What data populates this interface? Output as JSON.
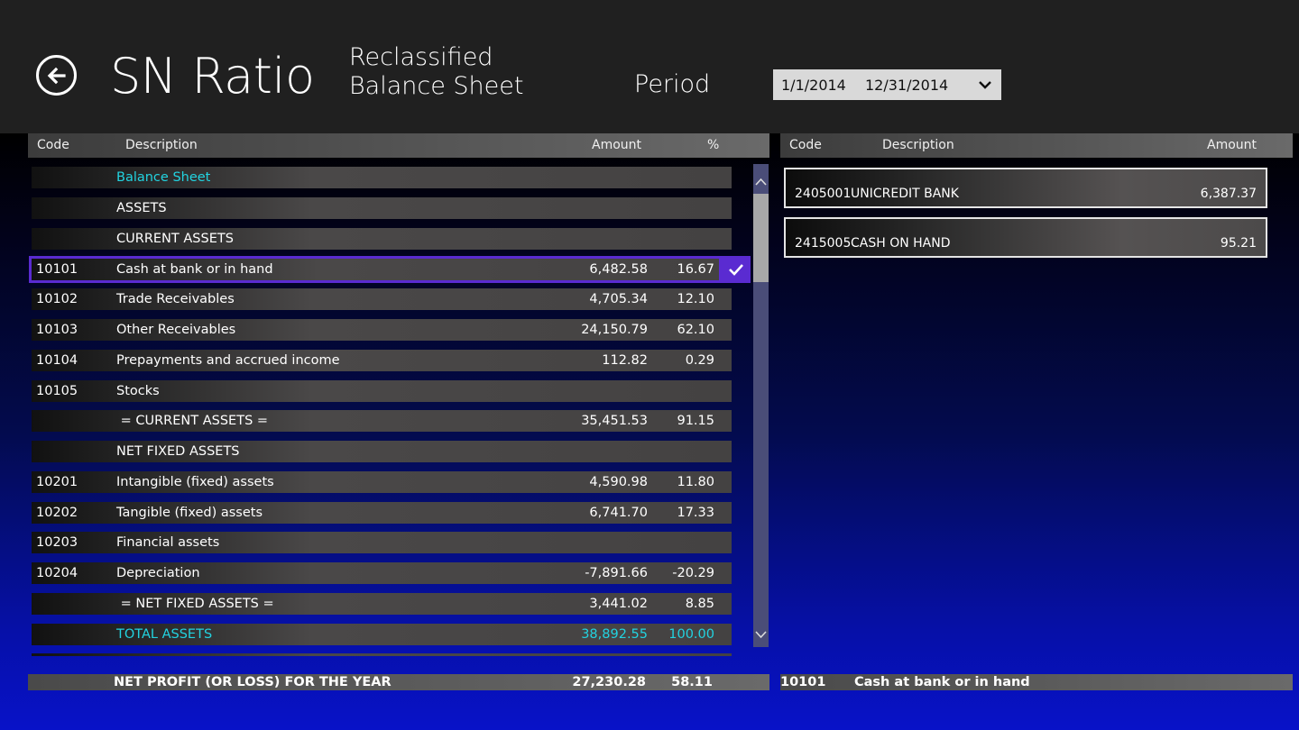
{
  "header": {
    "app_title": "SN Ratio",
    "report_title": "Reclassified Balance Sheet",
    "period_label": "Period",
    "period_from": "1/1/2014",
    "period_to": "12/31/2014"
  },
  "left_table": {
    "columns": {
      "code": "Code",
      "description": "Description",
      "amount": "Amount",
      "percent": "%"
    },
    "rows": [
      {
        "code": "",
        "description": "Balance Sheet",
        "amount": "",
        "percent": ""
      },
      {
        "code": "",
        "description": "ASSETS",
        "amount": "",
        "percent": ""
      },
      {
        "code": "",
        "description": "CURRENT ASSETS",
        "amount": "",
        "percent": ""
      },
      {
        "code": "10101",
        "description": "Cash at bank or in hand",
        "amount": "6,482.58",
        "percent": "16.67"
      },
      {
        "code": "10102",
        "description": "Trade Receivables",
        "amount": "4,705.34",
        "percent": "12.10"
      },
      {
        "code": "10103",
        "description": "Other Receivables",
        "amount": "24,150.79",
        "percent": "62.10"
      },
      {
        "code": "10104",
        "description": "Prepayments and accrued income",
        "amount": "112.82",
        "percent": "0.29"
      },
      {
        "code": "10105",
        "description": "Stocks",
        "amount": "",
        "percent": ""
      },
      {
        "code": "",
        "description": " = CURRENT ASSETS =",
        "amount": "35,451.53",
        "percent": "91.15"
      },
      {
        "code": "",
        "description": "NET FIXED ASSETS",
        "amount": "",
        "percent": ""
      },
      {
        "code": "10201",
        "description": "Intangible (fixed) assets",
        "amount": "4,590.98",
        "percent": "11.80"
      },
      {
        "code": "10202",
        "description": "Tangible (fixed) assets",
        "amount": "6,741.70",
        "percent": "17.33"
      },
      {
        "code": "10203",
        "description": "Financial assets",
        "amount": "",
        "percent": ""
      },
      {
        "code": "10204",
        "description": "Depreciation",
        "amount": "-7,891.66",
        "percent": "-20.29"
      },
      {
        "code": "",
        "description": " = NET FIXED ASSETS =",
        "amount": "3,441.02",
        "percent": "8.85"
      },
      {
        "code": "",
        "description": "TOTAL ASSETS",
        "amount": "38,892.55",
        "percent": "100.00"
      }
    ]
  },
  "right_table": {
    "columns": {
      "code": "Code",
      "description": "Description",
      "amount": "Amount"
    },
    "items": [
      {
        "code": "2405001",
        "description": "UNICREDIT BANK",
        "amount": "6,387.37"
      },
      {
        "code": "2415005",
        "description": "CASH ON HAND",
        "amount": "95.21"
      }
    ]
  },
  "footer": {
    "left_label": "NET PROFIT (OR LOSS) FOR THE YEAR",
    "left_amount": "27,230.28",
    "left_percent": "58.11",
    "right_code": "10101",
    "right_description": "Cash at bank or in hand"
  },
  "icons": {
    "back": "back-arrow-icon",
    "dropdown": "chevron-down-icon",
    "selected": "checkmark-icon",
    "scroll_up": "chevron-up-icon",
    "scroll_down": "chevron-down-icon"
  },
  "colors": {
    "accent_selection": "#5a2bd1",
    "highlight_text": "#22d3e0",
    "header_bg": "#202020"
  }
}
